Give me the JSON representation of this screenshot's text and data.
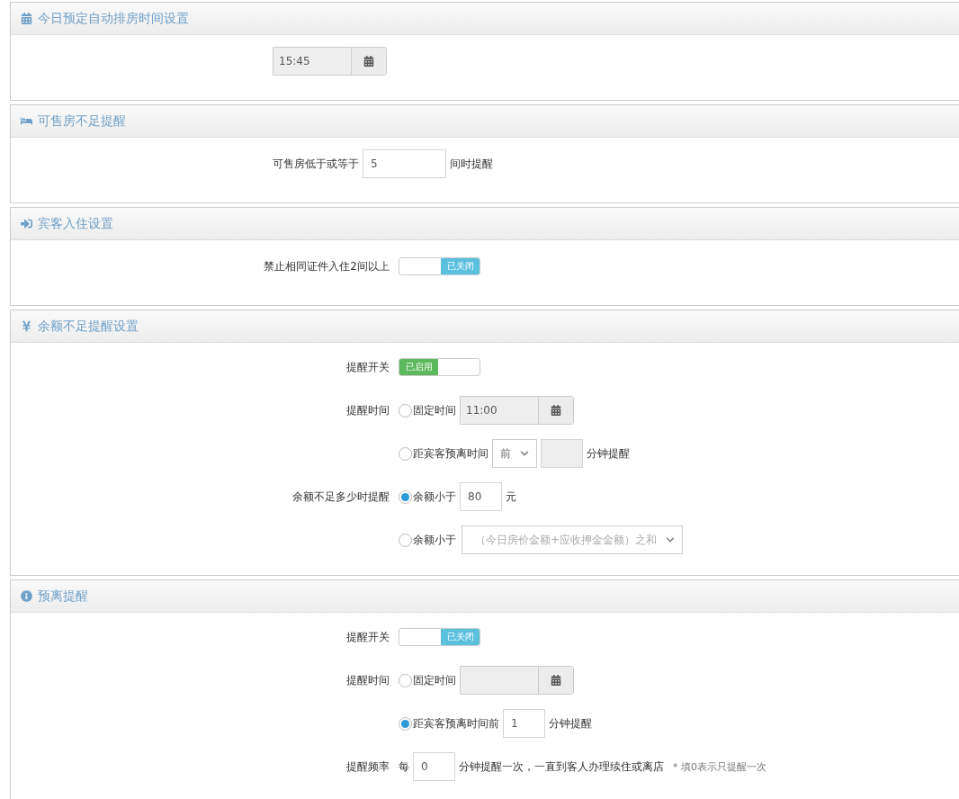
{
  "panels": [
    {
      "title": "今日预定自动排房时间设置",
      "rows": [
        {
          "kind": "inline",
          "controls": [
            {
              "kind": "time",
              "value": "15:45"
            }
          ]
        }
      ]
    },
    {
      "title": "可售房不足提醒",
      "rows": [
        {
          "kind": "inline",
          "controls": [
            {
              "kind": "text",
              "text": "可售房低于或等于"
            },
            {
              "kind": "input",
              "value": "5",
              "disabled": false
            },
            {
              "kind": "text",
              "text": "间时提醒"
            }
          ]
        }
      ]
    },
    {
      "title": "宾客入住设置",
      "rows": [
        {
          "kind": "labeled",
          "label": "禁止相同证件入住2间以上",
          "controls": [
            {
              "kind": "toggle",
              "on": false,
              "text": "已关闭"
            }
          ]
        }
      ]
    },
    {
      "title": "余额不足提醒设置",
      "rows": [
        {
          "kind": "labeled",
          "label": "提醒开关",
          "controls": [
            {
              "kind": "toggle",
              "on": true,
              "text": "已启用"
            }
          ]
        },
        {
          "kind": "labeled",
          "label": "提醒时间",
          "controls": [
            {
              "kind": "radio",
              "selected": false,
              "text": "固定时间"
            },
            {
              "kind": "time",
              "value": "11:00"
            }
          ]
        },
        {
          "kind": "labeled",
          "controls": [
            {
              "kind": "radio",
              "selected": false,
              "text": "距宾客预离时间"
            },
            {
              "kind": "select",
              "value": "前"
            },
            {
              "kind": "input",
              "disabled": true
            },
            {
              "kind": "text",
              "text": "分钟提醒"
            }
          ]
        },
        {
          "kind": "labeled",
          "label": "余额不足多少时提醒",
          "controls": [
            {
              "kind": "radio",
              "selected": true,
              "text": "余额小于"
            },
            {
              "kind": "input",
              "value": "80",
              "disabled": false
            },
            {
              "kind": "text",
              "text": "元"
            }
          ]
        },
        {
          "kind": "labeled",
          "controls": [
            {
              "kind": "radio",
              "selected": false,
              "text": "余额小于"
            },
            {
              "kind": "select",
              "value": "（今日房价金额+应收押金金额）之和"
            }
          ]
        }
      ]
    },
    {
      "title": "预离提醒",
      "rows": [
        {
          "kind": "labeled",
          "label": "提醒开关",
          "controls": [
            {
              "kind": "toggle",
              "on": false,
              "text": "已关闭"
            }
          ]
        },
        {
          "kind": "labeled",
          "label": "提醒时间",
          "controls": [
            {
              "kind": "radio",
              "selected": false,
              "text": "固定时间"
            },
            {
              "kind": "time"
            }
          ]
        },
        {
          "kind": "labeled",
          "controls": [
            {
              "kind": "radio",
              "selected": true,
              "text": "距宾客预离时间前"
            },
            {
              "kind": "input",
              "value": "1",
              "disabled": false
            },
            {
              "kind": "text",
              "text": "分钟提醒"
            }
          ]
        },
        {
          "kind": "labeled",
          "label": "提醒频率",
          "controls": [
            {
              "kind": "text",
              "text": "每"
            },
            {
              "kind": "input",
              "value": "0",
              "disabled": false
            },
            {
              "kind": "text",
              "text": "分钟提醒一次，一直到客人办理续住或离店"
            },
            {
              "kind": "hint",
              "text": "* 填0表示只提醒一次"
            }
          ]
        }
      ]
    }
  ]
}
